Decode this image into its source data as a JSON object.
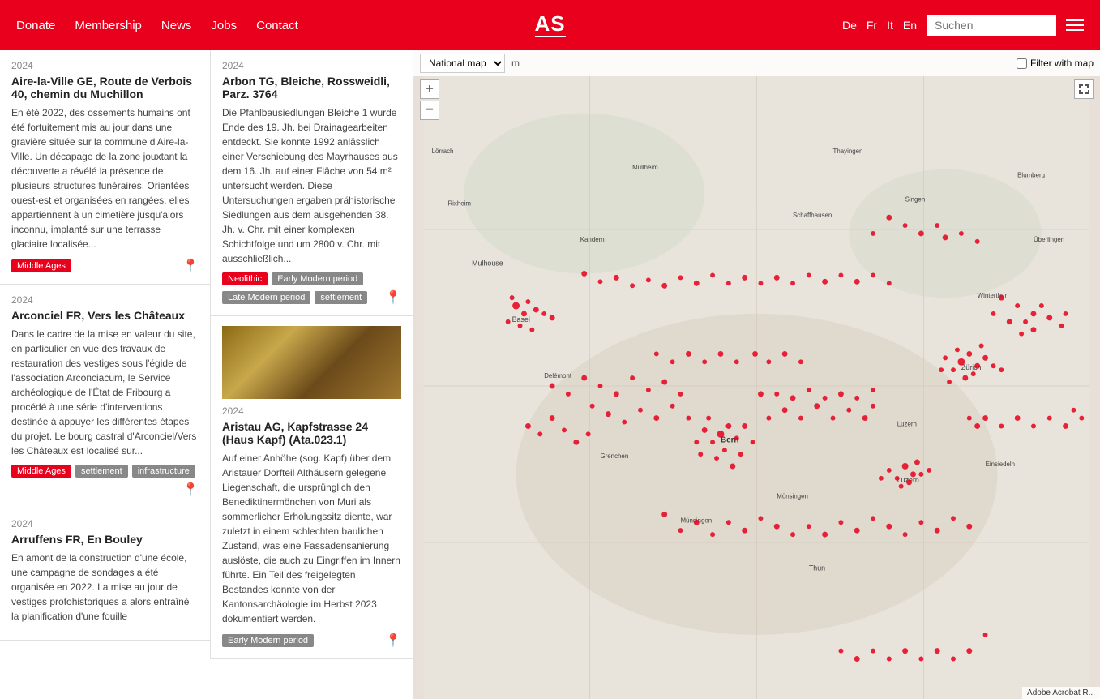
{
  "header": {
    "donate_label": "Donate",
    "membership_label": "Membership",
    "news_label": "News",
    "jobs_label": "Jobs",
    "contact_label": "Contact",
    "logo_text": "AS",
    "lang_de": "De",
    "lang_fr": "Fr",
    "lang_it": "It",
    "lang_en": "En",
    "search_placeholder": "Suchen"
  },
  "map": {
    "select_label": "National map",
    "filter_label": "Filter with map",
    "zoom_in": "+",
    "zoom_out": "−"
  },
  "cards": [
    {
      "year": "2024",
      "title": "Aire-la-Ville GE, Route de Verbois 40, chemin du Muchillon",
      "body": "En été 2022, des ossements humains ont été fortuitement mis au jour dans une gravière située sur la commune d'Aire-la-Ville. Un décapage de la zone jouxtant la découverte a révélé la présence de plusieurs structures funéraires. Orientées ouest-est et organisées en rangées, elles appartiennent à un cimetière jusqu'alors inconnu, implanté sur une terrasse glaciaire localisée...",
      "tags": [
        "Middle Ages"
      ],
      "col": "left"
    },
    {
      "year": "2024",
      "title": "Arbon TG, Bleiche, Rossweidli, Parz. 3764",
      "body": "Die Pfahlbausiedlungen Bleiche 1 wurde Ende des 19. Jh. bei Drainagearbeiten entdeckt. Sie konnte 1992 anlässlich einer Verschiebung des Mayrhauses aus dem 16. Jh. auf einer Fläche von 54 m² untersucht werden. Diese Untersuchungen ergaben prähistorische Siedlungen aus dem ausgehenden 38. Jh. v. Chr. mit einer komplexen Schichtfolge und um 2800 v. Chr. mit ausschließlich...",
      "tags": [
        "Neolithic",
        "Early Modern period",
        "Late Modern period",
        "settlement"
      ],
      "col": "right"
    },
    {
      "year": "2024",
      "title": "Arconciel FR, Vers les Châteaux",
      "body": "Dans le cadre de la mise en valeur du site, en particulier en vue des travaux de restauration des vestiges sous l'égide de l'association Arconciacum, le Service archéologique de l'État de Fribourg a procédé à une série d'interventions destinée à appuyer les différentes étapes du projet.\nLe bourg castral d'Arconciel/Vers les Châteaux est localisé sur...",
      "tags": [
        "Middle Ages",
        "settlement",
        "infrastructure"
      ],
      "col": "left"
    },
    {
      "year": "2024",
      "title": "Aristau AG, Kapfstrasse 24 (Haus Kapf) (Ata.023.1)",
      "body": "Auf einer Anhöhe (sog. Kapf) über dem Aristauer Dorfteil Althäusern gelegene Liegenschaft, die ursprünglich den Benediktinermönchen von Muri als sommerlicher Erholungssitz diente, war zuletzt in einem schlechten baulichen Zustand, was eine Fassadensanierung auslöste, die auch zu Eingriffen im Innern führte. Ein Teil des freigelegten Bestandes konnte von der Kantonsarchäologie im Herbst 2023 dokumentiert werden.",
      "tags": [
        "Early Modern period"
      ],
      "has_image": true,
      "col": "right"
    },
    {
      "year": "2024",
      "title": "Arruffens FR, En Bouley",
      "body": "En amont de la construction d'une école, une campagne de sondages a été organisée en 2022. La mise au jour de vestiges protohistoriques a alors entraîné la planification d'une fouille",
      "tags": [],
      "col": "left"
    }
  ],
  "acrobat_badge": "Adobe Acrobat R..."
}
